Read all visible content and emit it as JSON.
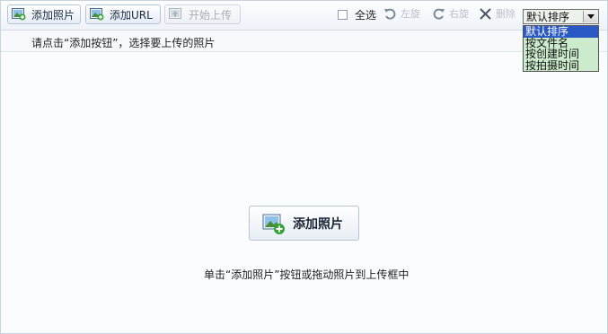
{
  "toolbar": {
    "add_photo": "添加照片",
    "add_url": "添加URL",
    "start_upload": "开始上传",
    "select_all": "全选",
    "rotate_left": "左旋",
    "rotate_right": "右旋",
    "delete": "删除"
  },
  "sort": {
    "selected": "默认排序",
    "options": [
      "默认排序",
      "按文件名",
      "按创建时间",
      "按拍摄时间"
    ]
  },
  "hint": "请点击“添加按钮”，选择要上传的照片",
  "main": {
    "add_button": "添加照片",
    "drop_text": "单击“添加照片”按钮或拖动照片到上传框中"
  }
}
